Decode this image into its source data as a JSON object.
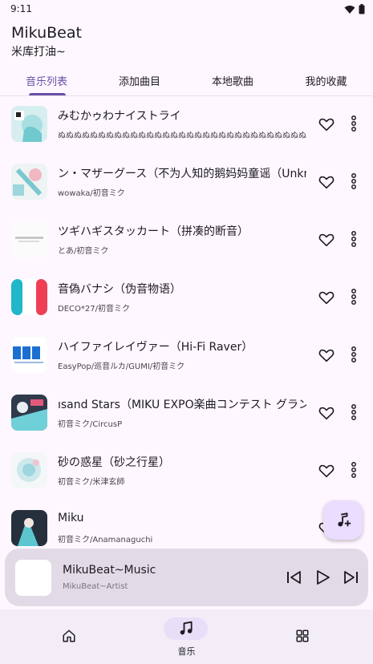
{
  "status": {
    "time": "9:11"
  },
  "app": {
    "title": "MikuBeat",
    "subtitle": "米库打油~"
  },
  "tabs": [
    {
      "label": "音乐列表",
      "active": true
    },
    {
      "label": "添加曲目",
      "active": false
    },
    {
      "label": "本地歌曲",
      "active": false
    },
    {
      "label": "我的收藏",
      "active": false
    }
  ],
  "songs": [
    {
      "title": "みむかゥわナイストライ",
      "artist": "ぬぬぬぬぬぬぬぬぬぬぬぬぬぬぬぬぬぬぬぬぬぬぬぬぬぬぬぬぬぬぬぬぬぬぬぬぬぬぬぬぬぬ"
    },
    {
      "title": "ン・マザーグース（不为人知的鹅妈妈童谣（Unknown Mother Goose））",
      "artist": "wowaka/初音ミク"
    },
    {
      "title": "ツギハギスタッカート（拼凑的断音）",
      "artist": "とあ/初音ミク"
    },
    {
      "title": "音偽バナシ（伪音物语）",
      "artist": "DECO*27/初音ミク"
    },
    {
      "title": "ハイファイレイヴァー（Hi-Fi Raver）",
      "artist": "EasyPop/巡音ルカ/GUMI/初音ミク"
    },
    {
      "title": "ısand Stars（MIKU EXPO楽曲コンテスト グランプリ）",
      "artist": "初音ミク/CircusP"
    },
    {
      "title": "砂の惑星（砂之行星）",
      "artist": "初音ミク/米津玄師"
    },
    {
      "title": "Miku",
      "artist": "初音ミク/Anamanaguchi"
    }
  ],
  "player": {
    "title": "MikuBeat~Music",
    "artist": "MikuBeat~Artist"
  },
  "nav": {
    "music_label": "音乐"
  },
  "colors": {
    "accent": "#6750a4",
    "background": "#fef7ff",
    "player_bg": "#e2dbe7",
    "fab_bg": "#eaddff"
  },
  "icons": [
    "wifi-icon",
    "battery-icon",
    "heart-icon",
    "more-vert-icon",
    "add-music-icon",
    "skip-previous-icon",
    "play-icon",
    "skip-next-icon",
    "home-icon",
    "music-note-icon",
    "grid-icon"
  ]
}
